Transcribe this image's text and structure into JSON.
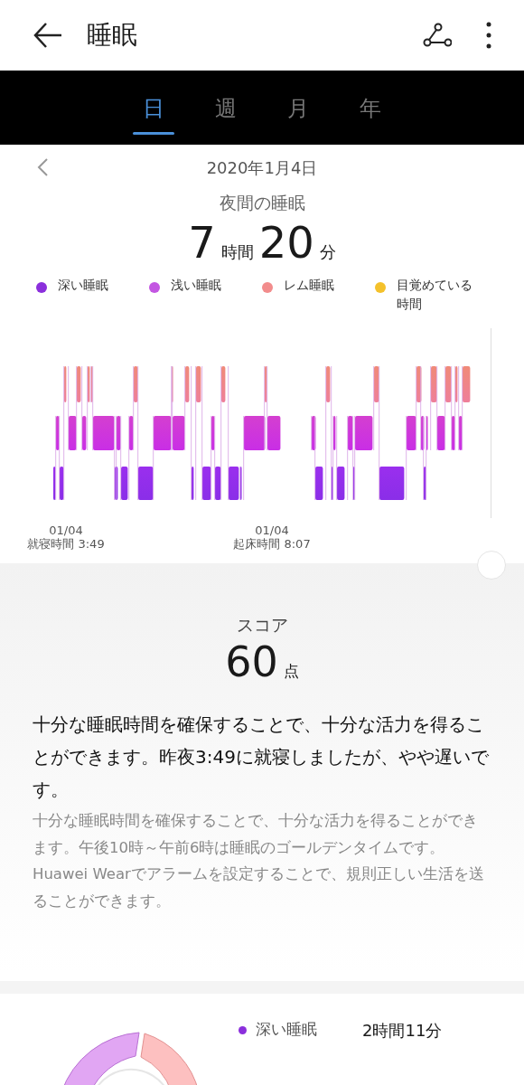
{
  "header": {
    "title": "睡眠"
  },
  "tabs": [
    {
      "label": "日",
      "selected": true
    },
    {
      "label": "週",
      "selected": false
    },
    {
      "label": "月",
      "selected": false
    },
    {
      "label": "年",
      "selected": false
    }
  ],
  "date": "2020年1月4日",
  "summary": {
    "title": "夜間の睡眠",
    "hours": "7",
    "hours_unit": "時間",
    "minutes": "20",
    "minutes_unit": "分"
  },
  "legend": [
    {
      "label": "深い睡眠",
      "color": "#8b2fdc"
    },
    {
      "label": "浅い睡眠",
      "color": "#c356e2"
    },
    {
      "label": "レム睡眠",
      "color": "#f28c8c"
    },
    {
      "label": "目覚めている時間",
      "color": "#f4c12b"
    }
  ],
  "chart_labels": [
    {
      "date": "01/04",
      "text": "就寝時間 3:49"
    },
    {
      "date": "01/04",
      "text": "起床時間 8:07"
    }
  ],
  "score": {
    "label": "スコア",
    "value": "60",
    "unit": "点"
  },
  "advice": "十分な睡眠時間を確保することで、十分な活力を得ることができます。昨夜3:49に就寝しましたが、やや遅いです。",
  "detail": "十分な睡眠時間を確保することで、十分な活力を得ることができます。午後10時～午前6時は睡眠のゴールデンタイムです。Huawei Wearでアラームを設定することで、規則正しい生活を送ることができます。",
  "breakdown": [
    {
      "label": "深い睡眠",
      "color": "#8b2fdc",
      "value": "2時間11分"
    }
  ]
}
